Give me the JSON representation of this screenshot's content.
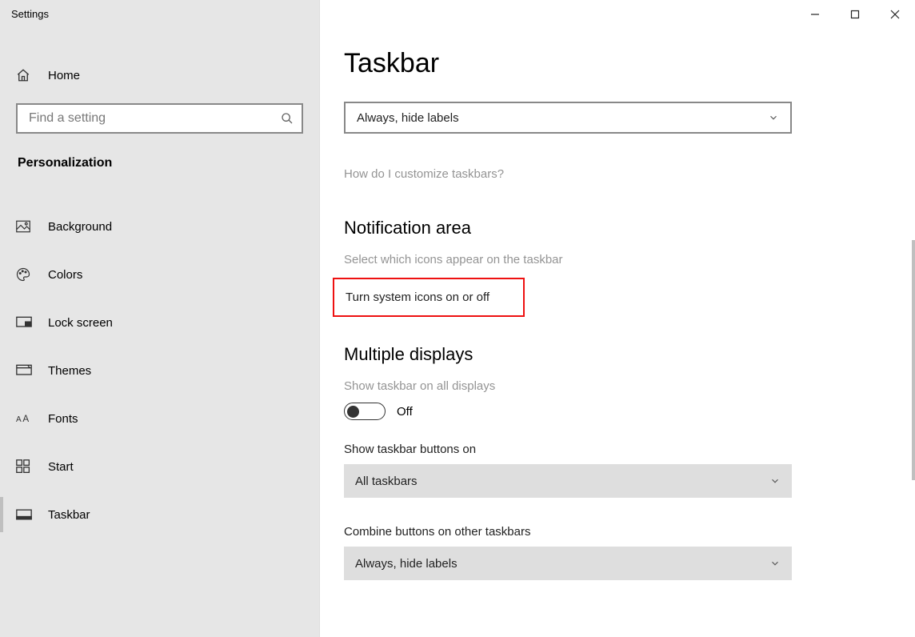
{
  "app_title": "Settings",
  "home": {
    "label": "Home"
  },
  "search": {
    "placeholder": "Find a setting"
  },
  "section": "Personalization",
  "nav": [
    {
      "id": "background",
      "label": "Background"
    },
    {
      "id": "colors",
      "label": "Colors"
    },
    {
      "id": "lock-screen",
      "label": "Lock screen"
    },
    {
      "id": "themes",
      "label": "Themes"
    },
    {
      "id": "fonts",
      "label": "Fonts"
    },
    {
      "id": "start",
      "label": "Start"
    },
    {
      "id": "taskbar",
      "label": "Taskbar",
      "active": true
    }
  ],
  "main": {
    "title": "Taskbar",
    "top_dropdown": "Always, hide labels",
    "help_link": "How do I customize taskbars?",
    "notification": {
      "header": "Notification area",
      "link1": "Select which icons appear on the taskbar",
      "link2": "Turn system icons on or off"
    },
    "multiple": {
      "header": "Multiple displays",
      "toggle_label": "Show taskbar on all displays",
      "toggle_state": "Off",
      "show_on_label": "Show taskbar buttons on",
      "show_on_value": "All taskbars",
      "combine_label": "Combine buttons on other taskbars",
      "combine_value": "Always, hide labels"
    }
  }
}
